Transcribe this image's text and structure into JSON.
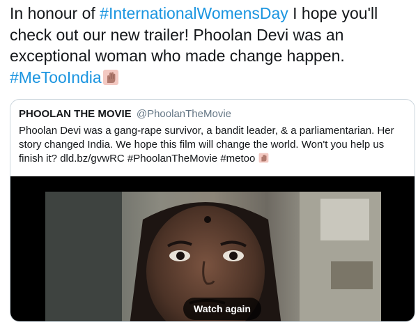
{
  "tweet": {
    "line1_pre": "In honour of ",
    "hashtag_iwd": "#InternationalWomensDay",
    "line1_post": " I hope you'll check out our new trailer! Phoolan Devi was an exceptional woman who made change happen. ",
    "hashtag_metooindia": "#MeTooIndia",
    "emoji": "raised-fist-emoji"
  },
  "quote": {
    "display_name": "PHOOLAN THE MOVIE",
    "handle": "@PhoolanTheMovie",
    "body": "Phoolan Devi was a  gang-rape survivor, a bandit leader, & a  parliamentarian. Her story changed India. We hope this film will change  the world. Won't you help us finish it? dld.bz/gvwRC  #PhoolanTheMovie #metoo",
    "emoji": "raised-fist-emoji"
  },
  "video": {
    "watch_again_label": "Watch again"
  },
  "colors": {
    "text": "#14171a",
    "hashtag": "#1b95e0",
    "handle": "#657786",
    "border": "#ccd6dd"
  }
}
